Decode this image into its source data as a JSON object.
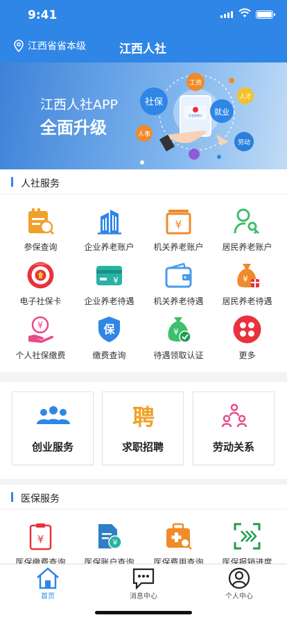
{
  "status_bar": {
    "time": "9:41"
  },
  "nav": {
    "location": "江西省省本级",
    "title": "江西人社"
  },
  "banner": {
    "line1": "江西人社APP",
    "line2": "全面升级",
    "bubbles": {
      "center": "社保",
      "wage": "工资",
      "talent": "人才",
      "employment": "就业",
      "hr": "人事",
      "labor": "劳动"
    },
    "card_text": "社会保障卡"
  },
  "hr_services": {
    "title": "人社服务",
    "badge_text": "SOCIAL SECURITY CARD",
    "items": [
      {
        "label": "参保查询",
        "icon": "insurance-query-icon"
      },
      {
        "label": "企业养老账户",
        "icon": "building-icon"
      },
      {
        "label": "机关养老账户",
        "icon": "yuan-cabinet-icon"
      },
      {
        "label": "居民养老账户",
        "icon": "person-key-icon"
      },
      {
        "label": "电子社保卡",
        "icon": "social-security-badge-icon"
      },
      {
        "label": "企业养老待遇",
        "icon": "yuan-card-icon"
      },
      {
        "label": "机关养老待遇",
        "icon": "wallet-icon"
      },
      {
        "label": "居民养老待遇",
        "icon": "money-bag-icon"
      },
      {
        "label": "个人社保缴费",
        "icon": "hand-yuan-icon"
      },
      {
        "label": "缴费查询",
        "icon": "shield-pay-icon"
      },
      {
        "label": "待遇领取认证",
        "icon": "money-check-icon"
      },
      {
        "label": "更多",
        "icon": "more-grid-icon"
      }
    ]
  },
  "feature_cards": [
    {
      "label": "创业服务",
      "icon": "team-icon"
    },
    {
      "label": "求职招聘",
      "icon": "recruit-character-icon",
      "glyph": "聘"
    },
    {
      "label": "劳动关系",
      "icon": "org-chart-icon"
    }
  ],
  "medical": {
    "title": "医保服务",
    "items": [
      {
        "label": "医保缴费查询",
        "icon": "clipboard-yuan-icon"
      },
      {
        "label": "医保账户查询",
        "icon": "document-yuan-icon"
      },
      {
        "label": "医保费用查询",
        "icon": "medkit-search-icon"
      },
      {
        "label": "医保报销进度",
        "icon": "scan-progress-icon"
      }
    ]
  },
  "tabbar": [
    {
      "label": "首页",
      "icon": "home-icon",
      "active": true
    },
    {
      "label": "消息中心",
      "icon": "message-icon",
      "active": false
    },
    {
      "label": "个人中心",
      "icon": "user-icon",
      "active": false
    }
  ],
  "colors": {
    "primary": "#2f86e6",
    "orange": "#f0a12a",
    "green": "#3dbf6b",
    "red": "#e8323c",
    "teal": "#26b3a5",
    "pink": "#e84a8a"
  }
}
